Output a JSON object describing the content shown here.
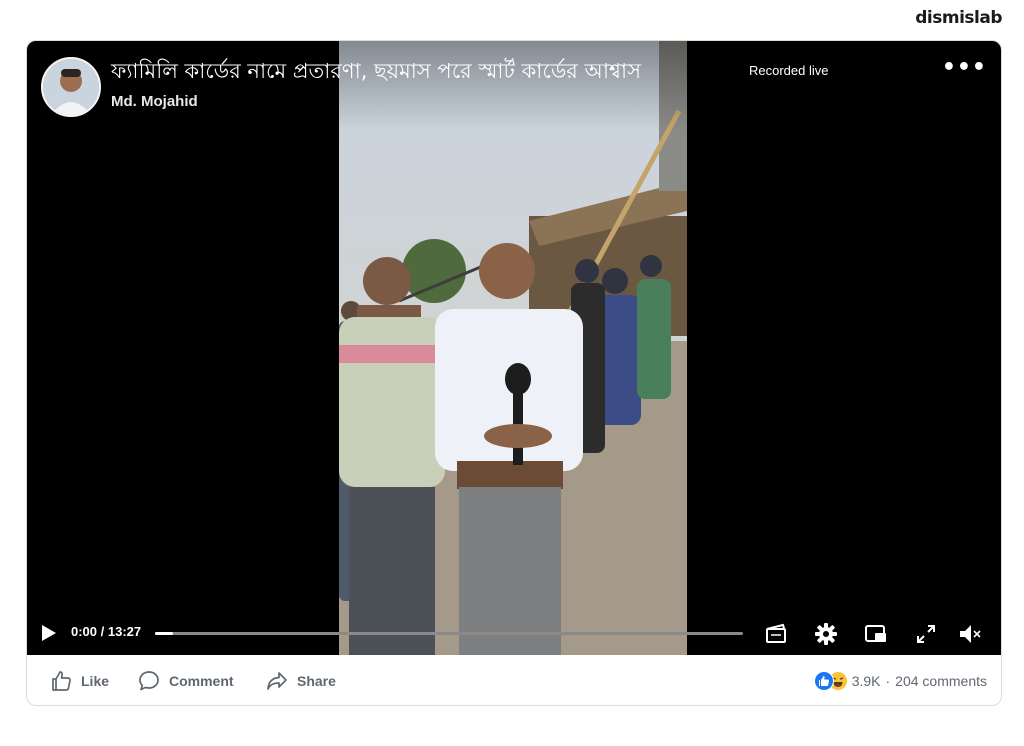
{
  "watermark": "dismislab",
  "post": {
    "title": "ফ্যামিলি কার্ডের নামে প্রতারণা, ছয়মাস পরে স্মার্ট কার্ডের আশ্বাস",
    "badge": "Recorded live",
    "author": "Md. Mojahid",
    "more_icon": "•••"
  },
  "player": {
    "time_text": "0:00 / 13:27",
    "progress_fraction": 0.0,
    "icons": [
      "play-icon",
      "clip-icon",
      "gear-icon",
      "picture-in-picture-icon",
      "fullscreen-icon",
      "volume-muted-icon"
    ]
  },
  "footer": {
    "like_label": "Like",
    "comment_label": "Comment",
    "share_label": "Share",
    "reactions_count": "3.9K",
    "separator": "·",
    "comments_text": "204 comments"
  },
  "colors": {
    "player_bg": "#000000",
    "like_blue": "#1877f2",
    "haha_yellow": "#f7c33b",
    "footer_text": "#606770",
    "card_border": "#cfe3cf"
  }
}
